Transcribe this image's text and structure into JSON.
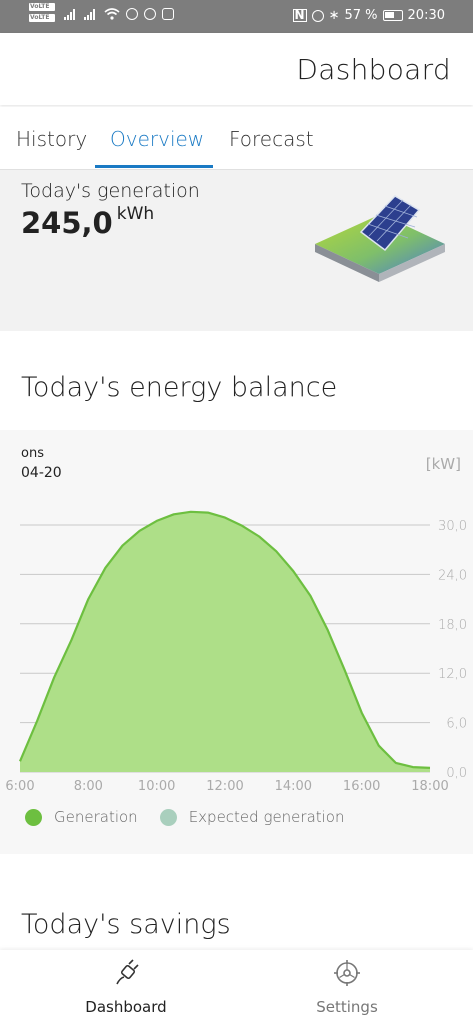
{
  "status_bar": {
    "volte_1": "VoLTE",
    "volte_2": "VoLTE",
    "nfc_icon": "N",
    "battery_percent": "57 %",
    "time": "20:30",
    "icons": [
      "signal-icon",
      "signal-icon",
      "wifi-icon",
      "messenger-icon",
      "whatsapp-icon",
      "instagram-icon",
      "nfc-icon",
      "alarm-icon",
      "bluetooth-icon",
      "battery-icon"
    ]
  },
  "header": {
    "title": "Dashboard"
  },
  "tabs": [
    {
      "label": "History",
      "active": false
    },
    {
      "label": "Overview",
      "active": true
    },
    {
      "label": "Forecast",
      "active": false
    }
  ],
  "generation": {
    "label": "Today's generation",
    "value": "245,0",
    "unit": "kWh"
  },
  "energy_balance": {
    "title": "Today's energy balance",
    "day": "ons",
    "date": "04-20",
    "unit": "[kW]"
  },
  "chart_data": {
    "type": "area",
    "title": "",
    "xlabel": "",
    "ylabel": "[kW]",
    "x_ticks": [
      "6:00",
      "8:00",
      "10:00",
      "12:00",
      "14:00",
      "16:00",
      "18:00"
    ],
    "y_ticks": [
      "0,0",
      "6,0",
      "12,0",
      "18,0",
      "24,0",
      "30,0"
    ],
    "xlim": [
      6,
      18
    ],
    "ylim": [
      0,
      30
    ],
    "grid": true,
    "series": [
      {
        "name": "Generation",
        "color": "#6dbf40",
        "fill": "#aedf88",
        "x": [
          6.0,
          6.5,
          7.0,
          7.5,
          8.0,
          8.5,
          9.0,
          9.5,
          10.0,
          10.5,
          11.0,
          11.5,
          12.0,
          12.5,
          13.0,
          13.5,
          14.0,
          14.5,
          15.0,
          15.5,
          16.0,
          16.5,
          17.0,
          17.5,
          18.0
        ],
        "y": [
          1.3,
          6.2,
          11.5,
          16.0,
          21.0,
          24.8,
          27.5,
          29.3,
          30.5,
          31.3,
          31.6,
          31.5,
          30.9,
          29.9,
          28.6,
          26.8,
          24.4,
          21.4,
          17.3,
          12.4,
          7.2,
          3.2,
          1.1,
          0.6,
          0.5
        ]
      }
    ],
    "legend": [
      {
        "label": "Generation",
        "color": "#6dbf40"
      },
      {
        "label": "Expected generation",
        "color": "#a9cfbd"
      }
    ],
    "legend_position": "bottom-left"
  },
  "savings": {
    "title": "Today's savings"
  },
  "bottom_nav": [
    {
      "label": "Dashboard",
      "icon": "plug-icon",
      "active": true
    },
    {
      "label": "Settings",
      "icon": "gear-icon",
      "active": false
    }
  ]
}
